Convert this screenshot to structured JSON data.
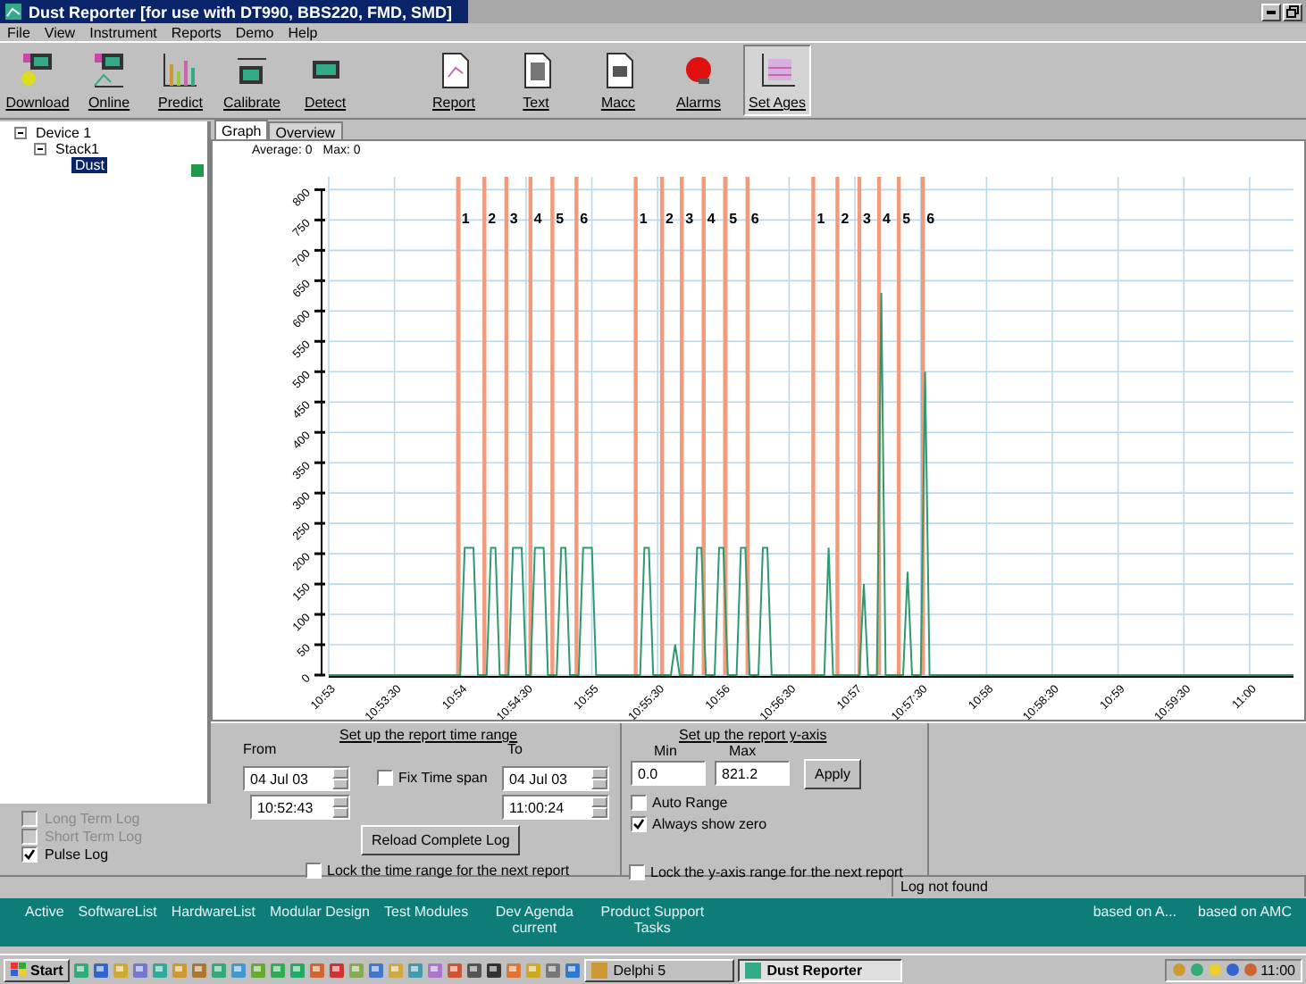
{
  "window": {
    "title": "Dust Reporter [for use with DT990, BBS220, FMD, SMD]"
  },
  "menu": [
    "File",
    "View",
    "Instrument",
    "Reports",
    "Demo",
    "Help"
  ],
  "toolbar": [
    {
      "label": "Download",
      "pressed": false
    },
    {
      "label": "Online",
      "pressed": false
    },
    {
      "label": "Predict",
      "pressed": false
    },
    {
      "label": "Calibrate",
      "pressed": false
    },
    {
      "label": "Detect",
      "pressed": false
    },
    {
      "label": "Report",
      "pressed": false
    },
    {
      "label": "Text",
      "pressed": false
    },
    {
      "label": "Macc",
      "pressed": false
    },
    {
      "label": "Alarms",
      "pressed": false
    },
    {
      "label": "Set Ages",
      "pressed": true
    }
  ],
  "tree": [
    {
      "label": "Device 1",
      "expanded": true,
      "children": [
        {
          "label": "Stack1",
          "expanded": true,
          "children": [
            {
              "label": "Dust",
              "selected": true,
              "color": "#1f9a4a"
            }
          ]
        }
      ]
    }
  ],
  "log_options": [
    {
      "label": "Long Term Log",
      "checked": false,
      "disabled": true
    },
    {
      "label": "Short Term Log",
      "checked": false,
      "disabled": true
    },
    {
      "label": "Pulse Log",
      "checked": true,
      "disabled": false
    }
  ],
  "tabs": [
    {
      "label": "Graph",
      "selected": true
    },
    {
      "label": "Overview",
      "selected": false
    }
  ],
  "summary": {
    "average": "Average: 0",
    "max": "Max: 0"
  },
  "chart_data": {
    "type": "line",
    "categories": [
      "10:53",
      null,
      null,
      null,
      null,
      null,
      null,
      null,
      null,
      null,
      null,
      null,
      null,
      null,
      null,
      "10:53:30",
      null,
      null,
      null,
      null,
      null,
      null,
      null,
      null,
      null,
      null,
      null,
      null,
      null,
      null,
      "10:54",
      null,
      null,
      null,
      null,
      null,
      null,
      null,
      null,
      null,
      null,
      null,
      null,
      null,
      null,
      "10:54:30",
      null,
      null,
      null,
      null,
      null,
      null,
      null,
      null,
      null,
      null,
      null,
      null,
      null,
      null,
      "10:55",
      null,
      null,
      null,
      null,
      null,
      null,
      null,
      null,
      null,
      null,
      null,
      null,
      null,
      null,
      "10:55:30",
      null,
      null,
      null,
      null,
      null,
      null,
      null,
      null,
      null,
      null,
      null,
      null,
      null,
      null,
      "10:56",
      null,
      null,
      null,
      null,
      null,
      null,
      null,
      null,
      null,
      null,
      null,
      null,
      null,
      null,
      "10:56:30",
      null,
      null,
      null,
      null,
      null,
      null,
      null,
      null,
      null,
      null,
      null,
      null,
      null,
      null,
      "10:57",
      null,
      null,
      null,
      null,
      null,
      null,
      null,
      null,
      null,
      null,
      null,
      null,
      null,
      null,
      "10:57:30",
      null,
      null,
      null,
      null,
      null,
      null,
      null,
      null,
      null,
      null,
      null,
      null,
      null,
      null,
      "10:58",
      null,
      null,
      null,
      null,
      null,
      null,
      null,
      null,
      null,
      null,
      null,
      null,
      null,
      null,
      "10:58:30",
      null,
      null,
      null,
      null,
      null,
      null,
      null,
      null,
      null,
      null,
      null,
      null,
      null,
      null,
      "10:59",
      null,
      null,
      null,
      null,
      null,
      null,
      null,
      null,
      null,
      null,
      null,
      null,
      null,
      null,
      "10:59:30",
      null,
      null,
      null,
      null,
      null,
      null,
      null,
      null,
      null,
      null,
      null,
      null,
      null,
      null,
      "11:00",
      null,
      null,
      null,
      null,
      null,
      null,
      null,
      null,
      null,
      null
    ],
    "series": [
      {
        "color": "#2e9a6e",
        "values": [
          0,
          0,
          0,
          0,
          0,
          0,
          0,
          0,
          0,
          0,
          0,
          0,
          0,
          0,
          0,
          0,
          0,
          0,
          0,
          0,
          0,
          0,
          0,
          0,
          0,
          0,
          0,
          0,
          0,
          0,
          0,
          210,
          210,
          210,
          0,
          0,
          0,
          210,
          210,
          0,
          0,
          0,
          210,
          210,
          210,
          0,
          0,
          210,
          210,
          210,
          0,
          0,
          0,
          210,
          210,
          0,
          0,
          0,
          210,
          210,
          210,
          0,
          0,
          0,
          0,
          0,
          0,
          0,
          0,
          0,
          0,
          0,
          210,
          210,
          0,
          0,
          0,
          0,
          0,
          50,
          0,
          0,
          0,
          0,
          210,
          210,
          0,
          0,
          0,
          210,
          210,
          0,
          0,
          0,
          210,
          210,
          0,
          0,
          0,
          210,
          210,
          0,
          0,
          0,
          0,
          0,
          0,
          0,
          0,
          0,
          0,
          0,
          0,
          0,
          210,
          0,
          0,
          0,
          0,
          0,
          0,
          0,
          150,
          0,
          0,
          0,
          630,
          0,
          0,
          0,
          0,
          0,
          170,
          0,
          0,
          0,
          500,
          0,
          0,
          0,
          0,
          0,
          0,
          0,
          0,
          0,
          0,
          0,
          0,
          0,
          0,
          0,
          0,
          0,
          0,
          0,
          0,
          0,
          0,
          0,
          0,
          0,
          0,
          0,
          0,
          0,
          0,
          0,
          0,
          0,
          0,
          0,
          0,
          0,
          0,
          0,
          0,
          0,
          0,
          0,
          0,
          0,
          0,
          0,
          0,
          0,
          0,
          0,
          0,
          0,
          0,
          0,
          0,
          0,
          0,
          0,
          0,
          0,
          0,
          0,
          0,
          0,
          0,
          0,
          0,
          0,
          0,
          0,
          0,
          0,
          0,
          0,
          0,
          0,
          0,
          0,
          0,
          0,
          0,
          0,
          0
        ]
      }
    ],
    "ylim": [
      0,
      821.2
    ],
    "grid": true,
    "yticks": [
      0,
      50,
      100,
      150,
      200,
      250,
      300,
      350,
      400,
      450,
      500,
      550,
      600,
      650,
      700,
      750,
      800
    ],
    "annotations": [
      "1",
      "2",
      "3",
      "4",
      "5",
      "6",
      "1",
      "2",
      "3",
      "4",
      "5",
      "6",
      "1",
      "2",
      "3",
      "4",
      "5",
      "6"
    ]
  },
  "time_range": {
    "heading": "Set up the report time range",
    "from_label": "From",
    "from_date": "04 Jul 03",
    "from_time": "10:52:43",
    "fix_span": {
      "label": "Fix Time span",
      "checked": false
    },
    "to_label": "To",
    "to_date": "04 Jul 03",
    "to_time": "11:00:24",
    "reload_button": "Reload Complete Log",
    "lock": {
      "label": "Lock the time range for the next report",
      "checked": false
    }
  },
  "y_axis": {
    "heading": "Set up the report y-axis",
    "min_label": "Min",
    "min": "0.0",
    "max_label": "Max",
    "max": "821.2",
    "apply_button": "Apply",
    "auto_range": {
      "label": "Auto Range",
      "checked": false
    },
    "always_zero": {
      "label": "Always show zero",
      "checked": true
    },
    "lock": {
      "label": "Lock the  y-axis range for the next report",
      "checked": false
    }
  },
  "status_bar": {
    "message": "Log not found"
  },
  "links_bar": {
    "left": [
      "Active",
      "SoftwareList",
      "HardwareList",
      "Modular Design",
      "Test Modules",
      "Dev Agenda current",
      "Product Support Tasks"
    ],
    "right": [
      "based on A...",
      "based on AMC"
    ]
  },
  "taskbar": {
    "start": "Start",
    "tasks": [
      {
        "label": "Delphi 5",
        "selected": false
      },
      {
        "label": "Dust Reporter",
        "selected": true
      }
    ],
    "clock": "11:00"
  }
}
